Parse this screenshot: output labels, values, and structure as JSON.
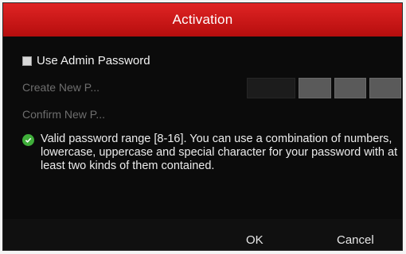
{
  "dialog": {
    "title": "Activation",
    "use_admin_password_label": "Use Admin Password",
    "use_admin_password_checked": false,
    "create_label": "Create New P...",
    "confirm_label": "Confirm New P...",
    "tip_icon": "check-circle-icon",
    "tip_text": "Valid password range [8-16]. You can use a combination of numbers, lowercase, uppercase and special character for your password with at least two kinds of them contained.",
    "ok_label": "OK",
    "cancel_label": "Cancel"
  },
  "colors": {
    "title_bar": "#d01818",
    "background": "#0b0b0b",
    "tip_icon": "#3fae3a"
  }
}
